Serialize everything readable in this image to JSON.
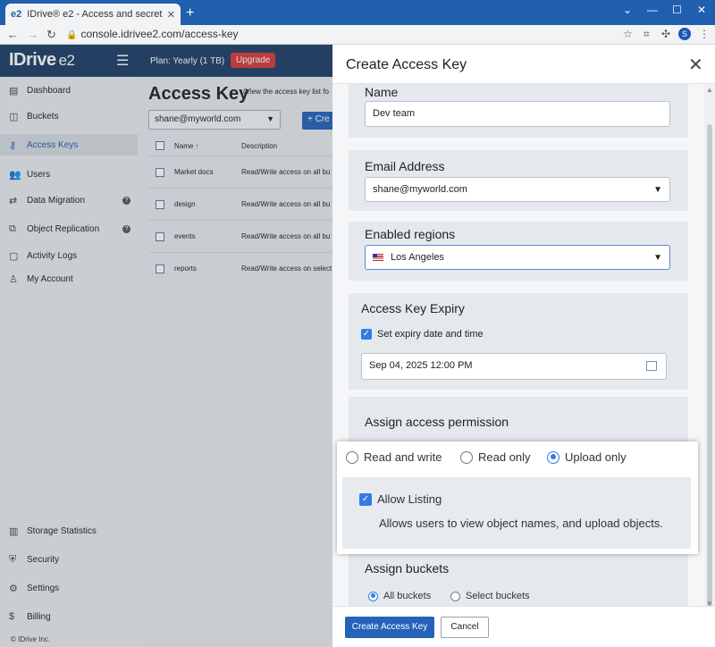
{
  "browser": {
    "tab_favicon": "e2",
    "tab_title": "IDrive® e2 - Access and secret k",
    "tab_close": "✕",
    "new_tab": "+",
    "url": "console.idrivee2.com/access-key",
    "profile_initial": "S",
    "window_controls": [
      "⌄",
      "—",
      "☐",
      "✕"
    ]
  },
  "brand": {
    "name": "IDrive",
    "suffix": "e2"
  },
  "header": {
    "plan": "Plan: Yearly (1 TB)",
    "upgrade": "Upgrade"
  },
  "sidebar": {
    "items": [
      {
        "label": "Dashboard",
        "icon": "dashboard-icon",
        "glyph": "▤"
      },
      {
        "label": "Buckets",
        "icon": "bucket-icon",
        "glyph": "◫"
      },
      {
        "label": "Access Keys",
        "icon": "key-icon",
        "glyph": "⚷",
        "active": true
      },
      {
        "label": "Users",
        "icon": "users-icon",
        "glyph": "👥"
      },
      {
        "label": "Data Migration",
        "icon": "migration-icon",
        "glyph": "⇄",
        "help": "?"
      },
      {
        "label": "Object Replication",
        "icon": "replication-icon",
        "glyph": "⧉",
        "help": "?"
      },
      {
        "label": "Activity Logs",
        "icon": "logs-icon",
        "glyph": "▢"
      },
      {
        "label": "My Account",
        "icon": "account-icon",
        "glyph": "♙"
      }
    ],
    "bottom_items": [
      {
        "label": "Storage Statistics",
        "icon": "statistics-icon",
        "glyph": "▥"
      },
      {
        "label": "Security",
        "icon": "security-icon",
        "glyph": "⛨"
      },
      {
        "label": "Settings",
        "icon": "settings-icon",
        "glyph": "⚙"
      },
      {
        "label": "Billing",
        "icon": "billing-icon",
        "glyph": "$"
      }
    ],
    "copyright": "© IDrive Inc."
  },
  "main": {
    "title": "Access Key",
    "subtitle": "(View the access key list fo",
    "user_select": "shane@myworld.com",
    "create_button": "+ Cre",
    "columns": [
      "Name",
      "Description"
    ],
    "rows": [
      {
        "name": "Market docs",
        "description": "Read/Write access on all bu"
      },
      {
        "name": "design",
        "description": "Read/Write access on all bu"
      },
      {
        "name": "events",
        "description": "Read/Write access on all bu"
      },
      {
        "name": "reports",
        "description": "Read/Write access on select"
      }
    ]
  },
  "panel": {
    "title": "Create Access Key",
    "name_label": "Name",
    "name_value": "Dev team",
    "email_label": "Email Address",
    "email_value": "shane@myworld.com",
    "regions_label": "Enabled regions",
    "region_value": "Los Angeles",
    "expiry_label": "Access Key Expiry",
    "expiry_checkbox": "Set expiry date and time",
    "expiry_value": "Sep 04, 2025 12:00 PM",
    "permission_label": "Assign access permission",
    "permission_options": [
      "Read and write",
      "Read only",
      "Upload only"
    ],
    "permission_selected": "Upload only",
    "allow_listing_label": "Allow Listing",
    "allow_listing_desc": "Allows users to view object names, and upload objects.",
    "buckets_label": "Assign buckets",
    "bucket_options": [
      "All buckets",
      "Select buckets"
    ],
    "bucket_selected": "All buckets",
    "create_button": "Create Access Key",
    "cancel_button": "Cancel"
  },
  "colors": {
    "primary": "#2563b9",
    "header": "#1e3f67",
    "upgrade": "#d63a3a",
    "tabbar": "#1f5fae"
  }
}
